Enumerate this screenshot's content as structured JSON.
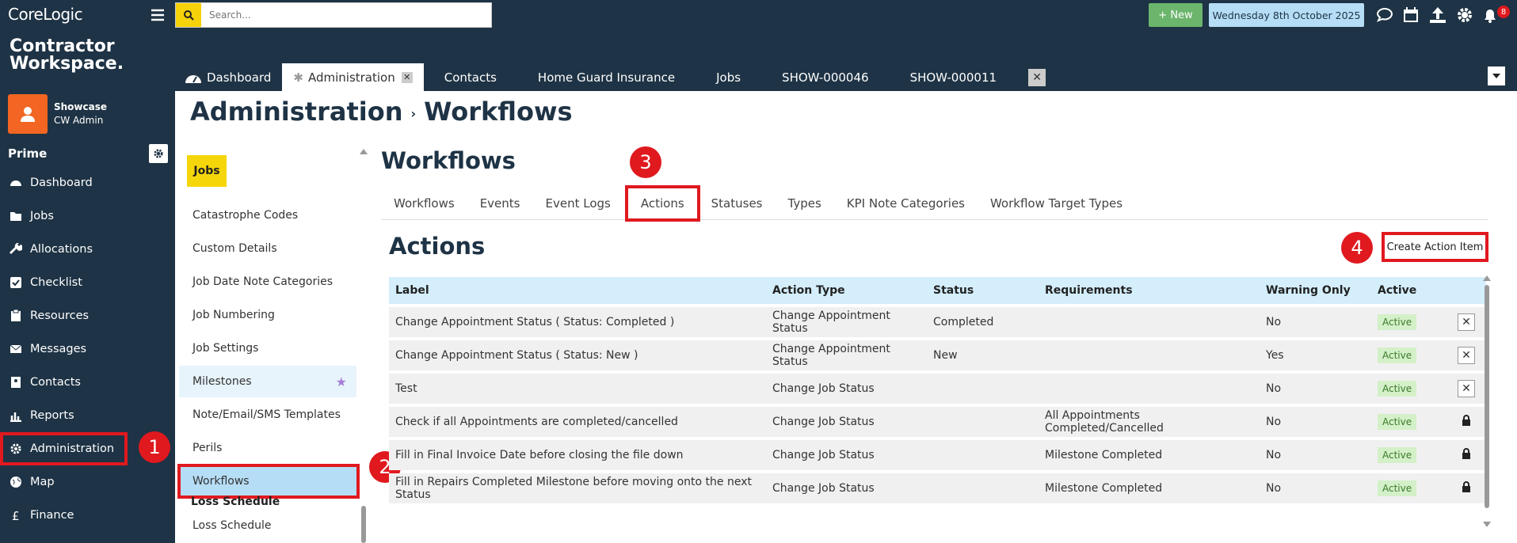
{
  "brand": {
    "logo_top": "CoreLogic",
    "logo_line1": "Contractor",
    "logo_line2": "Workspace."
  },
  "user": {
    "name": "Showcase",
    "role": "CW Admin"
  },
  "sidebar": {
    "section": "Prime",
    "items": [
      {
        "label": "Dashboard",
        "icon": "dashboard-icon"
      },
      {
        "label": "Jobs",
        "icon": "folder-icon"
      },
      {
        "label": "Allocations",
        "icon": "wrench-icon"
      },
      {
        "label": "Checklist",
        "icon": "checkbox-icon"
      },
      {
        "label": "Resources",
        "icon": "clipboard-icon"
      },
      {
        "label": "Messages",
        "icon": "envelope-icon"
      },
      {
        "label": "Contacts",
        "icon": "address-book-icon"
      },
      {
        "label": "Reports",
        "icon": "bar-chart-icon"
      },
      {
        "label": "Administration",
        "icon": "gear-icon"
      },
      {
        "label": "Map",
        "icon": "globe-icon"
      },
      {
        "label": "Finance",
        "icon": "pound-icon"
      }
    ]
  },
  "search": {
    "placeholder": "Search..."
  },
  "header": {
    "new_label": "+ New",
    "date": "Wednesday 8th October 2025",
    "notification_count": "8"
  },
  "tabs": [
    {
      "label": "Dashboard"
    },
    {
      "label": "Administration",
      "active": true
    },
    {
      "label": "Contacts"
    },
    {
      "label": "Home Guard Insurance"
    },
    {
      "label": "Jobs"
    },
    {
      "label": "SHOW-000046"
    },
    {
      "label": "SHOW-000011"
    }
  ],
  "breadcrumb": {
    "part1": "Administration",
    "sep": "›",
    "part2": "Workflows"
  },
  "submenu": {
    "group_jobs": "Jobs",
    "items": [
      "Catastrophe Codes",
      "Custom Details",
      "Job Date Note Categories",
      "Job Numbering",
      "Job Settings",
      "Milestones",
      "Note/Email/SMS Templates",
      "Perils",
      "Workflows"
    ],
    "group_loss": "Loss Schedule",
    "loss_items": [
      "Loss Schedule"
    ]
  },
  "workflows": {
    "title": "Workflows",
    "tabs": [
      "Workflows",
      "Events",
      "Event Logs",
      "Actions",
      "Statuses",
      "Types",
      "KPI Note Categories",
      "Workflow Target Types"
    ]
  },
  "actions": {
    "title": "Actions",
    "create_label": "Create Action Item",
    "columns": [
      "Label",
      "Action Type",
      "Status",
      "Requirements",
      "Warning Only",
      "Active"
    ],
    "rows": [
      {
        "label": "Change Appointment Status ( Status: Completed )",
        "type": "Change Appointment Status",
        "status": "Completed",
        "req": "",
        "warn": "No",
        "active": "Active",
        "ctrl": "x"
      },
      {
        "label": "Change Appointment Status ( Status: New )",
        "type": "Change Appointment Status",
        "status": "New",
        "req": "",
        "warn": "Yes",
        "active": "Active",
        "ctrl": "x"
      },
      {
        "label": "Test",
        "type": "Change Job Status",
        "status": "",
        "req": "",
        "warn": "No",
        "active": "Active",
        "ctrl": "x"
      },
      {
        "label": "Check if all Appointments are completed/cancelled",
        "type": "Change Job Status",
        "status": "",
        "req": "All Appointments Completed/Cancelled",
        "warn": "No",
        "active": "Active",
        "ctrl": "lock"
      },
      {
        "label": "Fill in Final Invoice Date before closing the file down",
        "type": "Change Job Status",
        "status": "",
        "req": "Milestone Completed",
        "warn": "No",
        "active": "Active",
        "ctrl": "lock"
      },
      {
        "label": "Fill in Repairs Completed Milestone before moving onto the next Status",
        "type": "Change Job Status",
        "status": "",
        "req": "Milestone Completed",
        "warn": "No",
        "active": "Active",
        "ctrl": "lock"
      }
    ]
  },
  "annotations": [
    "1",
    "2",
    "3",
    "4"
  ]
}
